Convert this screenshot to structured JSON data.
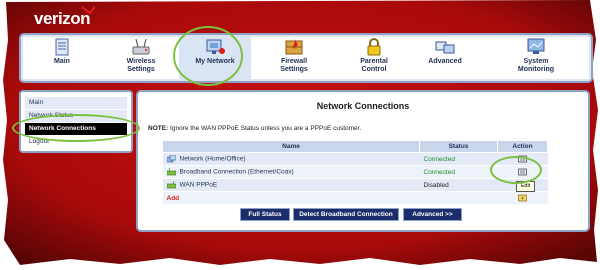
{
  "brand": {
    "name": "verizon"
  },
  "tabs": [
    {
      "label": "Main",
      "icon": "main-icon"
    },
    {
      "label": "Wireless\nSettings",
      "icon": "wireless-icon"
    },
    {
      "label": "My Network",
      "icon": "network-icon"
    },
    {
      "label": "Firewall\nSettings",
      "icon": "firewall-icon"
    },
    {
      "label": "Parental\nControl",
      "icon": "lock-icon"
    },
    {
      "label": "Advanced",
      "icon": "advanced-icon"
    },
    {
      "label": "System\nMonitoring",
      "icon": "monitor-icon"
    }
  ],
  "active_tab": "My Network",
  "sidebar": {
    "items": [
      {
        "label": "Main"
      },
      {
        "label": "Network Status"
      },
      {
        "label": "Network Connections"
      },
      {
        "label": "Logout"
      }
    ],
    "active": "Network Connections"
  },
  "main": {
    "title": "Network Connections",
    "note_label": "NOTE:",
    "note_text": " Ignore the WAN PPPoE Status unless you are a PPPoE customer.",
    "table": {
      "headers": [
        "Name",
        "Status",
        "Action"
      ],
      "rows": [
        {
          "name": "Network (Home/Office)",
          "status": "Connected"
        },
        {
          "name": "Broadband Connection (Ethernet/Coax)",
          "status": "Connected"
        },
        {
          "name": "WAN PPPoE",
          "status": "Disabled"
        }
      ],
      "add_label": "Add"
    },
    "tooltip": "Edit",
    "buttons": {
      "full_status": "Full Status",
      "detect": "Detect Broadband Connection",
      "advanced": "Advanced >>"
    }
  },
  "colors": {
    "accent_red": "#e21b1b",
    "panel_border": "#8ea2c8",
    "status_connected": "#1c8a2e",
    "button_navy": "#1b2d6b",
    "highlight_ellipse": "#7dbf3f"
  }
}
